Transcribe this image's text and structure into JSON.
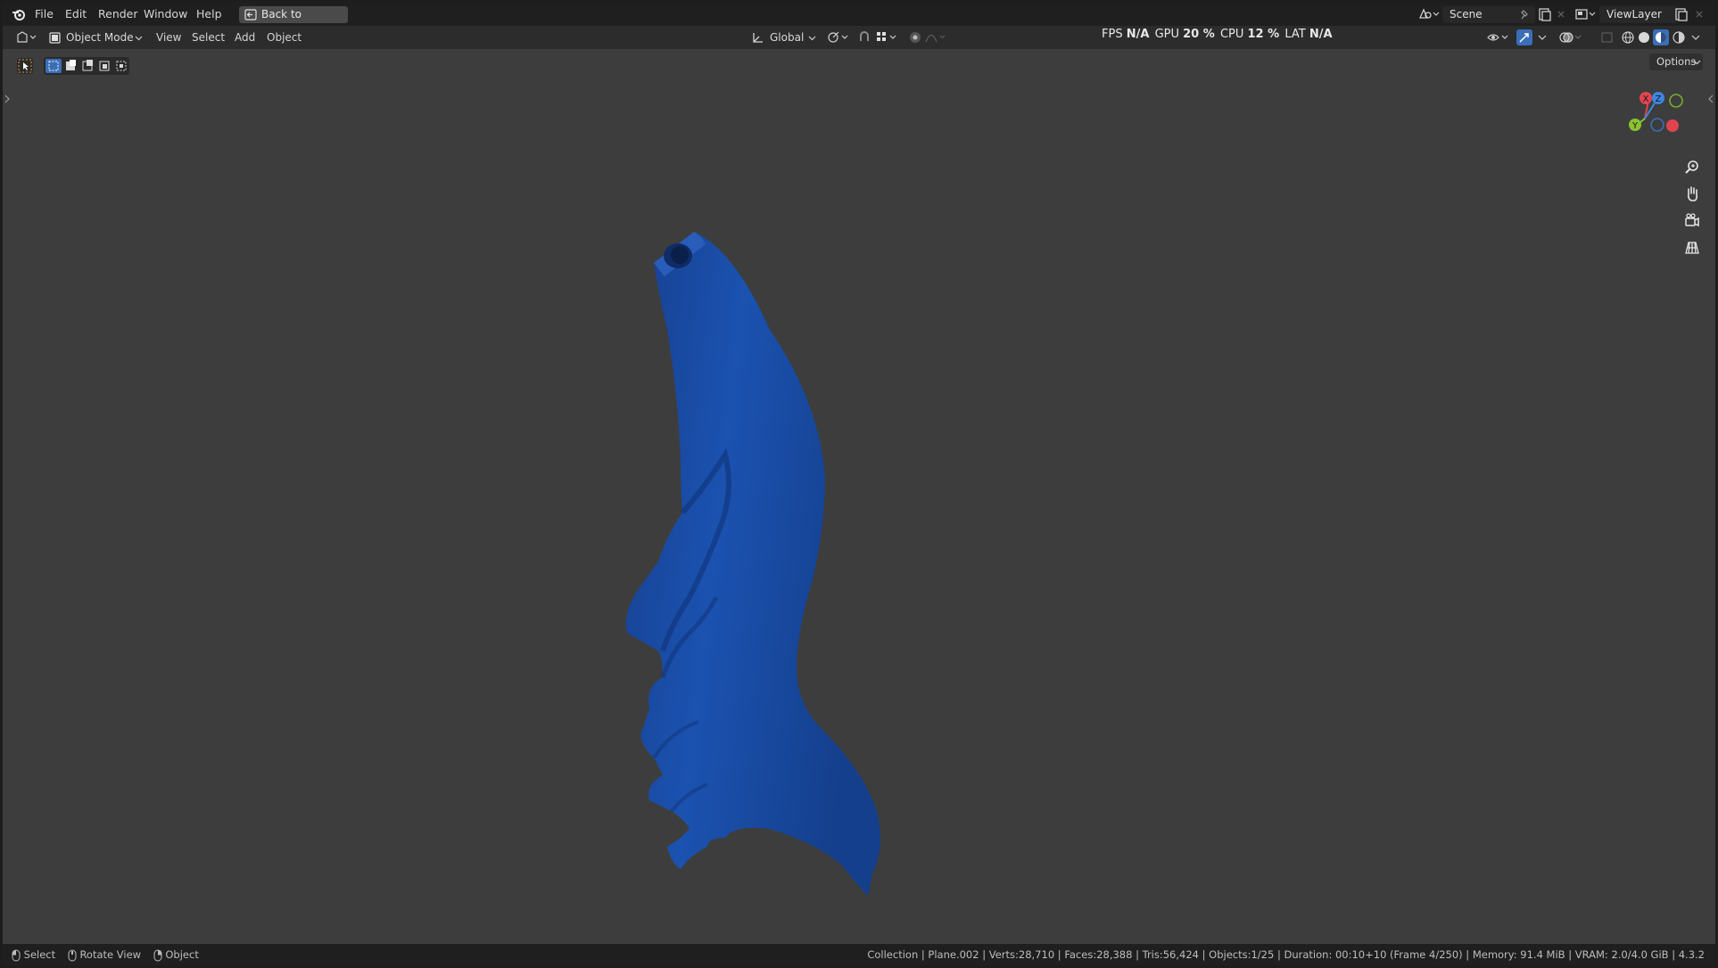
{
  "menu": {
    "items": [
      "File",
      "Edit",
      "Render",
      "Window",
      "Help"
    ],
    "back_button": "Back to Previous"
  },
  "scene_selector": {
    "value": "Scene"
  },
  "view_layer_selector": {
    "value": "ViewLayer"
  },
  "header": {
    "mode": "Object Mode",
    "menus": [
      "View",
      "Select",
      "Add",
      "Object"
    ],
    "transform_orientation": "Global",
    "options_label": "Options"
  },
  "stats": {
    "fps_label": "FPS",
    "fps_value": "N/A",
    "gpu_label": "GPU",
    "gpu_value": "20 %",
    "cpu_label": "CPU",
    "cpu_value": "12 %",
    "lat_label": "LAT",
    "lat_value": "N/A"
  },
  "gizmo": {
    "x": "X",
    "y": "Y",
    "z": "Z"
  },
  "statusbar": {
    "hints": [
      "Select",
      "Rotate View",
      "Object"
    ],
    "info": "Collection | Plane.002 | Verts:28,710 | Faces:28,388 | Tris:56,424 | Objects:1/25 | Duration: 00:10+10 (Frame 4/250) | Memory: 91.4 MiB | VRAM: 2.0/4.0 GiB | 4.3.2"
  },
  "colors": {
    "model_blue": "#1a4ea8",
    "axis_x": "#e0454f",
    "axis_y": "#8ac231",
    "axis_z": "#3d86e3"
  },
  "icons": [
    "blender-logo-icon",
    "back-arrow-icon",
    "scene-icon",
    "pin-icon",
    "new-scene-icon",
    "delete-icon",
    "view-layer-icon",
    "editor-type-icon",
    "object-mode-icon",
    "transform-orientation-icon",
    "pivot-icon",
    "snap-icon",
    "proportional-edit-icon",
    "visibility-icon",
    "gizmo-icon",
    "overlay-icon",
    "xray-icon",
    "wireframe-shading-icon",
    "solid-shading-icon",
    "material-shading-icon",
    "rendered-shading-icon",
    "zoom-icon",
    "pan-hand-icon",
    "camera-view-icon",
    "grid-view-icon",
    "select-tool-icon",
    "mouse-left-icon",
    "mouse-middle-icon",
    "mouse-right-icon"
  ]
}
